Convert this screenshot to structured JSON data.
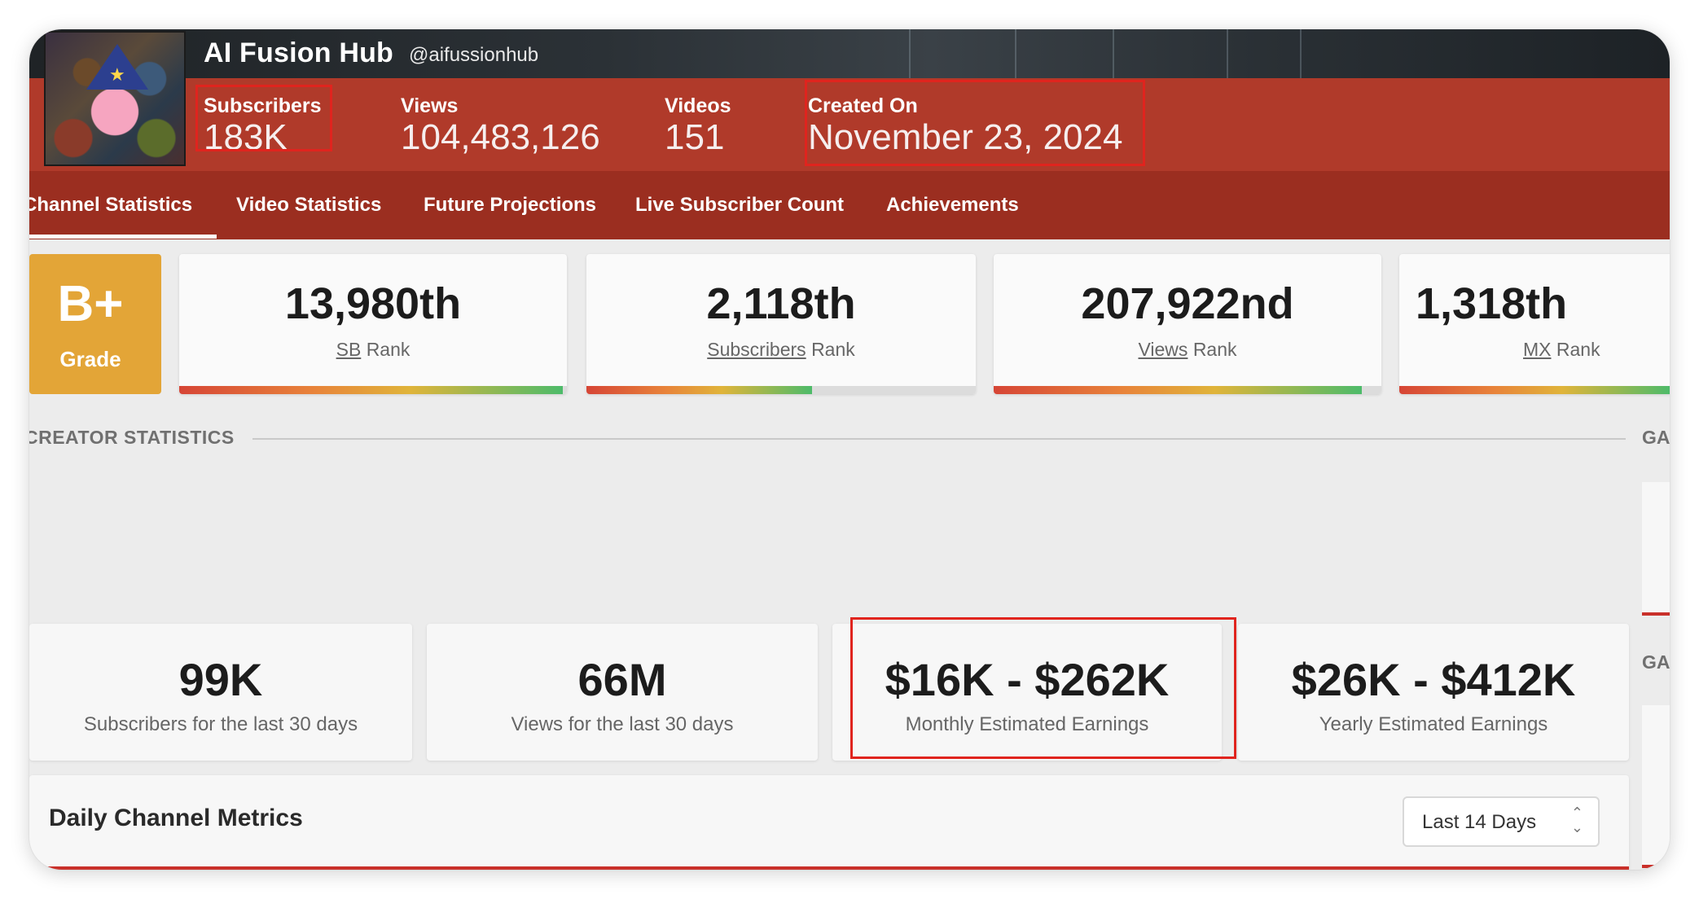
{
  "channel": {
    "name": "AI Fusion Hub",
    "handle": "@aifussionhub"
  },
  "stats": [
    {
      "label": "Subscribers",
      "value": "183K"
    },
    {
      "label": "Views",
      "value": "104,483,126"
    },
    {
      "label": "Videos",
      "value": "151"
    },
    {
      "label": "Created On",
      "value": "November 23, 2024"
    }
  ],
  "tabs": [
    {
      "label": "Channel Statistics"
    },
    {
      "label": "Video Statistics"
    },
    {
      "label": "Future Projections"
    },
    {
      "label": "Live Subscriber Count"
    },
    {
      "label": "Achievements"
    }
  ],
  "grade": {
    "value": "B+",
    "label": "Grade"
  },
  "ranks": [
    {
      "rank": "13,980th",
      "prefix": "SB",
      "suffix": "Rank",
      "fill": 0.99
    },
    {
      "rank": "2,118th",
      "prefix": "Subscribers",
      "suffix": "Rank",
      "fill": 0.58
    },
    {
      "rank": "207,922nd",
      "prefix": "Views",
      "suffix": "Rank",
      "fill": 0.95
    },
    {
      "rank": "1,318th",
      "prefix": "MX",
      "suffix": "Rank",
      "fill": 0.99
    }
  ],
  "section": {
    "title": "CREATOR STATISTICS",
    "side_label_1": "GA",
    "side_label_2": "GA"
  },
  "cards": [
    {
      "big": "99K",
      "sub": "Subscribers for the last 30 days"
    },
    {
      "big": "66M",
      "sub": "Views for the last 30 days"
    },
    {
      "big": "$16K - $262K",
      "sub": "Monthly Estimated Earnings"
    },
    {
      "big": "$26K - $412K",
      "sub": "Yearly Estimated Earnings"
    }
  ],
  "metrics": {
    "title": "Daily Channel Metrics",
    "range_value": "Last 14 Days"
  },
  "colors": {
    "header_red": "#b03a2a",
    "tab_red": "#9b2e20",
    "grade_gold": "#e3a537",
    "highlight_box": "#e0241e"
  }
}
